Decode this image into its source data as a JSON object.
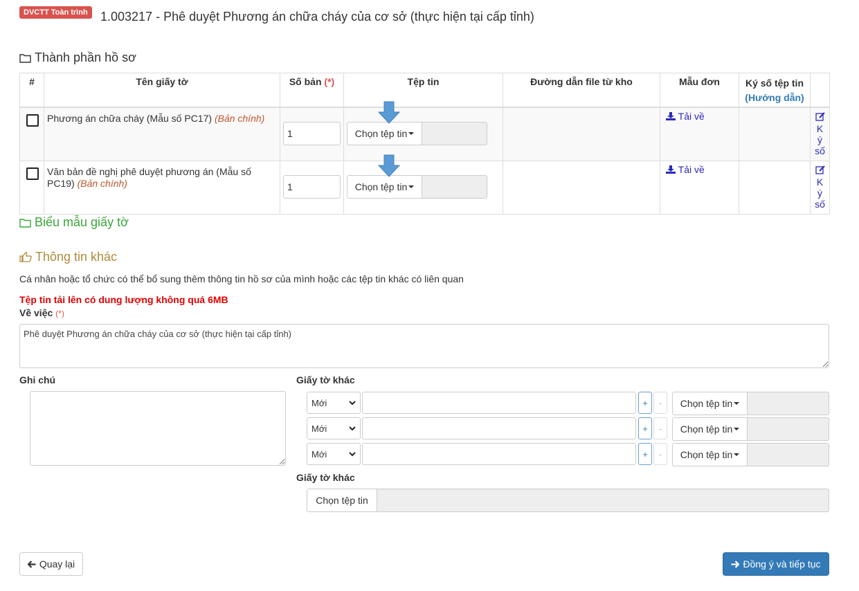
{
  "header": {
    "badge": "DVCTT Toàn trình",
    "title": "1.003217 - Phê duyệt Phương án chữa cháy của cơ sở (thực hiện tại cấp tỉnh)"
  },
  "documents_section": {
    "title": "Thành phần hồ sơ",
    "columns": {
      "index": "#",
      "name": "Tên giấy tờ",
      "copies": "Số bản",
      "copies_required": "(*)",
      "file": "Tệp tin",
      "path": "Đường dẫn file từ kho",
      "template": "Mẫu đơn",
      "sign": "Ký số tệp tin",
      "sign_help": "(Hướng dẫn)"
    },
    "rows": [
      {
        "name": "Phương án chữa cháy (Mẫu số PC17)",
        "note": "(Bản chính)",
        "copies": "1",
        "file_button": "Chọn tệp tin",
        "download": "Tải về",
        "sign": "Ký số"
      },
      {
        "name": "Văn bản đề nghị phê duyệt phương án (Mẫu số PC19)",
        "note": "(Bản chính)",
        "copies": "1",
        "file_button": "Chọn tệp tin",
        "download": "Tải về",
        "sign": "Ký số"
      }
    ]
  },
  "templates_section": {
    "title": "Biểu mẫu giấy tờ"
  },
  "other_info": {
    "title": "Thông tin khác",
    "description": "Cá nhân hoặc tổ chức có thể bổ sung thêm thông tin hồ sơ của mình hoặc các tệp tin khác có liên quan",
    "warning": "Tệp tin tải lên có dung lượng không quá 6MB",
    "subject_label": "Về việc",
    "subject_required": "(*)",
    "subject_value": "Phê duyệt Phương án chữa cháy của cơ sở (thực hiện tại cấp tỉnh)",
    "note_label": "Ghi chú",
    "other_docs_label": "Giấy tờ khác",
    "other_docs_rows": [
      {
        "select": "Mới",
        "plus": "+",
        "minus": "-",
        "file_button": "Chọn tệp tin"
      },
      {
        "select": "Mới",
        "plus": "+",
        "minus": "-",
        "file_button": "Chọn tệp tin"
      },
      {
        "select": "Mới",
        "plus": "+",
        "minus": "-",
        "file_button": "Chọn tệp tin"
      }
    ],
    "other_docs_label_2": "Giấy tờ khác",
    "other_file_button": "Chọn tệp tin"
  },
  "footer": {
    "back": "Quay lại",
    "next": "Đồng ý và tiếp tục"
  },
  "colors": {
    "badge": "#d9534f",
    "green_title": "#3aa63a",
    "gold_title": "#b08a3a",
    "primary": "#337ab7",
    "arrow": "#5b9bd5"
  }
}
